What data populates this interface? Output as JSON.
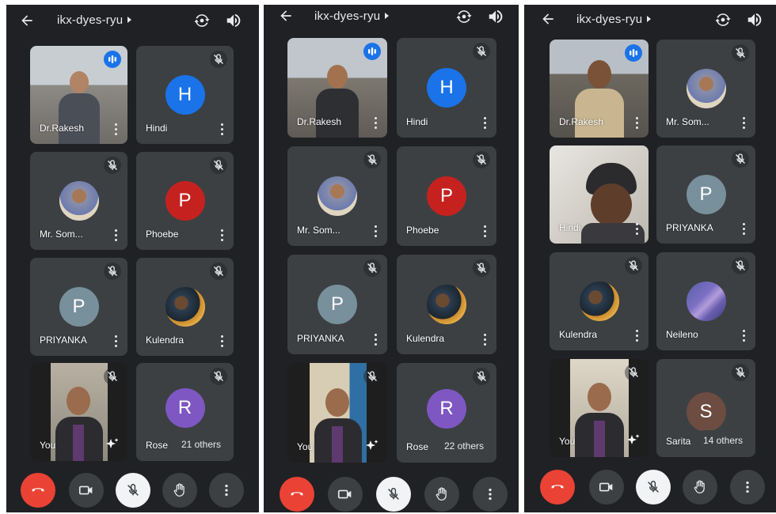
{
  "screens": [
    {
      "title": "ikx-dyes-ryu",
      "tiles": [
        "Dr.Rakesh",
        "Hindi",
        "Mr. Som...",
        "Phoebe",
        "PRIYANKA",
        "Kulendra",
        "You",
        "Rose"
      ],
      "avatars": {
        "hindi": "H",
        "phoebe": "P",
        "priyanka": "P",
        "rose": "R"
      },
      "others": "21 others"
    },
    {
      "title": "ikx-dyes-ryu",
      "tiles": [
        "Dr.Rakesh",
        "Hindi",
        "Mr. Som...",
        "Phoebe",
        "PRIYANKA",
        "Kulendra",
        "You",
        "Rose"
      ],
      "avatars": {
        "hindi": "H",
        "phoebe": "P",
        "priyanka": "P",
        "rose": "R"
      },
      "others": "22 others"
    },
    {
      "title": "ikx-dyes-ryu",
      "tiles": [
        "Dr.Rakesh",
        "Mr. Som...",
        "Hindi",
        "PRIYANKA",
        "Kulendra",
        "Neileno",
        "You",
        "Sarita"
      ],
      "avatars": {
        "priyanka": "P",
        "sarita": "S"
      },
      "others": "14 others"
    }
  ],
  "colors": {
    "background": "#202124",
    "tile": "#3c4043",
    "end_call": "#ea4335",
    "speaking": "#1a73e8",
    "avatar_h": "#1a73e8",
    "avatar_phoebe": "#c5221f",
    "avatar_priyanka": "#78909c",
    "avatar_rose": "#7e57c2",
    "avatar_sarita": "#6d4c41"
  }
}
